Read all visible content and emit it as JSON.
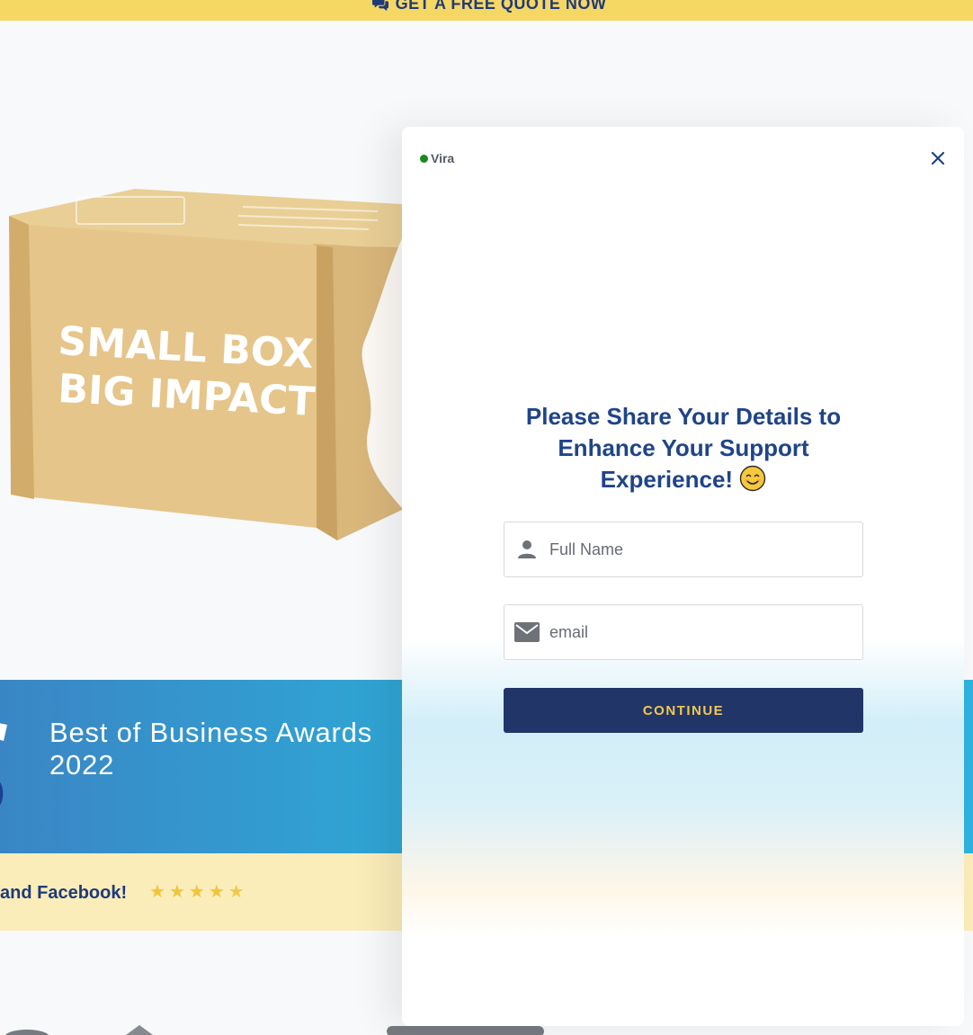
{
  "top_banner": {
    "label": "GET A FREE QUOTE NOW",
    "icon": "chat-bubbles-icon",
    "background": "#f5d764",
    "text_color": "#1f3a7a"
  },
  "product": {
    "box_line1": "SMALL BOX",
    "box_line2": "BIG IMPACT"
  },
  "awards": {
    "title": "Best of Business Awards 2022",
    "background": "#2ea9d6"
  },
  "reviews": {
    "text": "and Facebook!",
    "rating": 4.5,
    "star_color": "#f0c53a"
  },
  "chat": {
    "agent_name": "Vira",
    "status_color": "#1a8a1a",
    "heading": "Please Share Your Details to Enhance Your Support Experience!",
    "name_placeholder": "Full Name",
    "email_placeholder": "email",
    "continue_label": "CONTINUE",
    "button_color": "#223569",
    "button_text_color": "#f2c94c",
    "heading_color": "#1f4488"
  }
}
